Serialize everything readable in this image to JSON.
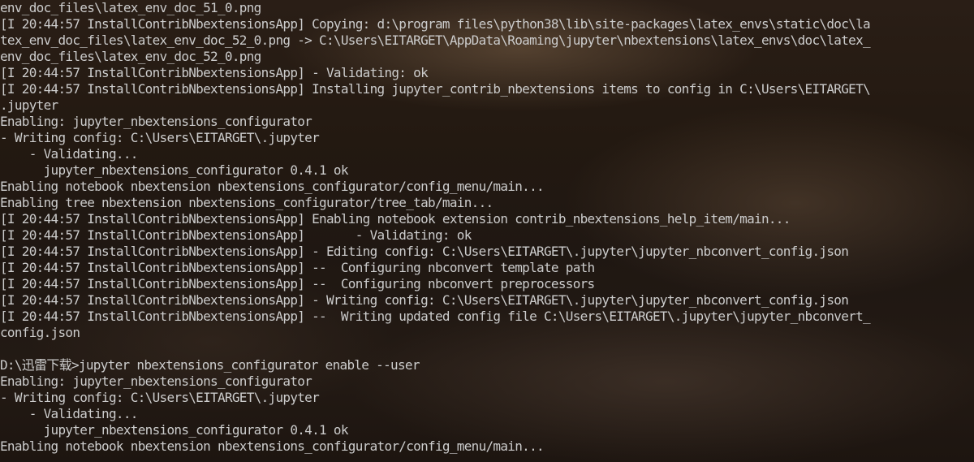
{
  "terminal": {
    "lines": [
      "env_doc_files\\latex_env_doc_51_0.png",
      "[I 20:44:57 InstallContribNbextensionsApp] Copying: d:\\program files\\python38\\lib\\site-packages\\latex_envs\\static\\doc\\la",
      "tex_env_doc_files\\latex_env_doc_52_0.png -> C:\\Users\\EITARGET\\AppData\\Roaming\\jupyter\\nbextensions\\latex_envs\\doc\\latex_",
      "env_doc_files\\latex_env_doc_52_0.png",
      "[I 20:44:57 InstallContribNbextensionsApp] - Validating: ok",
      "[I 20:44:57 InstallContribNbextensionsApp] Installing jupyter_contrib_nbextensions items to config in C:\\Users\\EITARGET\\",
      ".jupyter",
      "Enabling: jupyter_nbextensions_configurator",
      "- Writing config: C:\\Users\\EITARGET\\.jupyter",
      "    - Validating...",
      "      jupyter_nbextensions_configurator 0.4.1 ok",
      "Enabling notebook nbextension nbextensions_configurator/config_menu/main...",
      "Enabling tree nbextension nbextensions_configurator/tree_tab/main...",
      "[I 20:44:57 InstallContribNbextensionsApp] Enabling notebook extension contrib_nbextensions_help_item/main...",
      "[I 20:44:57 InstallContribNbextensionsApp]       - Validating: ok",
      "[I 20:44:57 InstallContribNbextensionsApp] - Editing config: C:\\Users\\EITARGET\\.jupyter\\jupyter_nbconvert_config.json",
      "[I 20:44:57 InstallContribNbextensionsApp] --  Configuring nbconvert template path",
      "[I 20:44:57 InstallContribNbextensionsApp] --  Configuring nbconvert preprocessors",
      "[I 20:44:57 InstallContribNbextensionsApp] - Writing config: C:\\Users\\EITARGET\\.jupyter\\jupyter_nbconvert_config.json",
      "[I 20:44:57 InstallContribNbextensionsApp] --  Writing updated config file C:\\Users\\EITARGET\\.jupyter\\jupyter_nbconvert_",
      "config.json",
      "",
      "D:\\迅雷下载>jupyter nbextensions_configurator enable --user",
      "Enabling: jupyter_nbextensions_configurator",
      "- Writing config: C:\\Users\\EITARGET\\.jupyter",
      "    - Validating...",
      "      jupyter_nbextensions_configurator 0.4.1 ok",
      "Enabling notebook nbextension nbextensions_configurator/config_menu/main..."
    ]
  },
  "colors": {
    "text": "#cccccc",
    "background": "#1f1712"
  }
}
